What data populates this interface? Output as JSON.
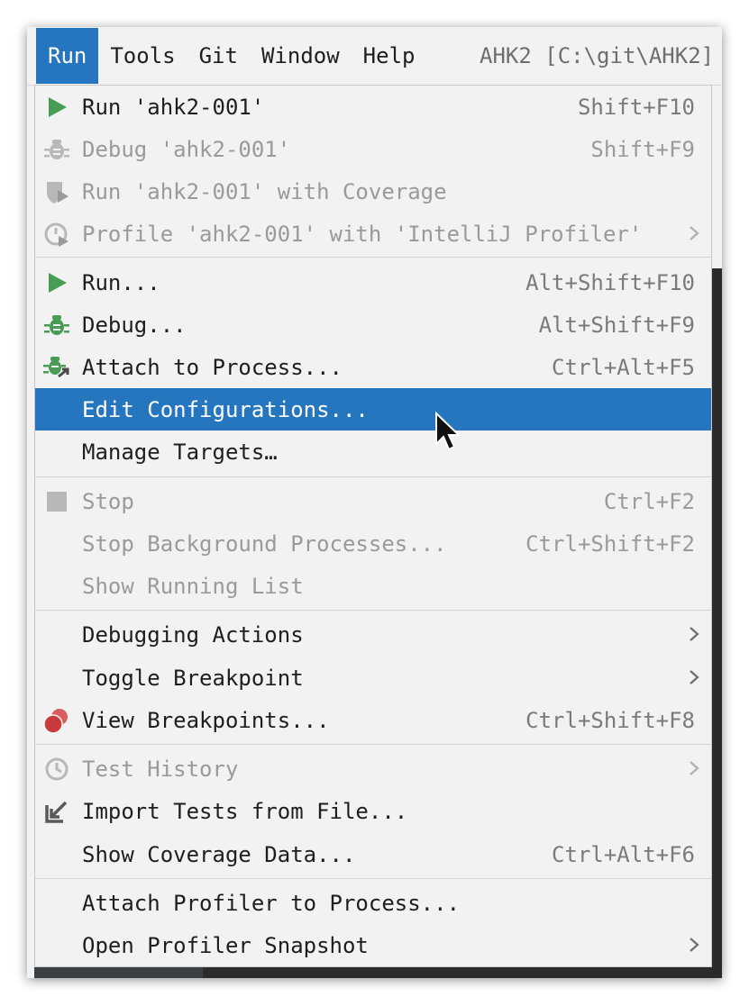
{
  "menubar": {
    "items": [
      {
        "label": "Run",
        "active": true
      },
      {
        "label": "Tools"
      },
      {
        "label": "Git"
      },
      {
        "label": "Window"
      },
      {
        "label": "Help"
      }
    ],
    "project_title": "AHK2 [C:\\git\\AHK2]"
  },
  "menu": {
    "rows": [
      {
        "label": "Run 'ahk2-001'",
        "shortcut": "Shift+F10",
        "icon": "run-play-icon",
        "enabled": true
      },
      {
        "label": "Debug 'ahk2-001'",
        "shortcut": "Shift+F9",
        "icon": "debug-bug-icon",
        "enabled": false
      },
      {
        "label": "Run 'ahk2-001' with Coverage",
        "shortcut": "",
        "icon": "coverage-shield-icon",
        "enabled": false
      },
      {
        "label": "Profile 'ahk2-001' with 'IntelliJ Profiler'",
        "shortcut": "",
        "icon": "profiler-icon",
        "enabled": false,
        "submenu": true
      },
      {
        "label": "Run...",
        "shortcut": "Alt+Shift+F10",
        "icon": "run-play-icon",
        "enabled": true
      },
      {
        "label": "Debug...",
        "shortcut": "Alt+Shift+F9",
        "icon": "debug-bug-icon",
        "enabled": true
      },
      {
        "label": "Attach to Process...",
        "shortcut": "Ctrl+Alt+F5",
        "icon": "attach-process-icon",
        "enabled": true
      },
      {
        "label": "Edit Configurations...",
        "shortcut": "",
        "icon": "",
        "enabled": true,
        "selected": true
      },
      {
        "label": "Manage Targets…",
        "shortcut": "",
        "icon": "",
        "enabled": true
      },
      {
        "label": "Stop",
        "shortcut": "Ctrl+F2",
        "icon": "stop-square-icon",
        "enabled": false
      },
      {
        "label": "Stop Background Processes...",
        "shortcut": "Ctrl+Shift+F2",
        "icon": "",
        "enabled": false
      },
      {
        "label": "Show Running List",
        "shortcut": "",
        "icon": "",
        "enabled": false
      },
      {
        "label": "Debugging Actions",
        "shortcut": "",
        "icon": "",
        "enabled": true,
        "submenu": true
      },
      {
        "label": "Toggle Breakpoint",
        "shortcut": "",
        "icon": "",
        "enabled": true,
        "submenu": true
      },
      {
        "label": "View Breakpoints...",
        "shortcut": "Ctrl+Shift+F8",
        "icon": "breakpoints-icon",
        "enabled": true
      },
      {
        "label": "Test History",
        "shortcut": "",
        "icon": "history-clock-icon",
        "enabled": false,
        "submenu": true
      },
      {
        "label": "Import Tests from File...",
        "shortcut": "",
        "icon": "import-arrow-icon",
        "enabled": true
      },
      {
        "label": "Show Coverage Data...",
        "shortcut": "Ctrl+Alt+F6",
        "icon": "",
        "enabled": true
      },
      {
        "label": "Attach Profiler to Process...",
        "shortcut": "",
        "icon": "",
        "enabled": true
      },
      {
        "label": "Open Profiler Snapshot",
        "shortcut": "",
        "icon": "",
        "enabled": true,
        "submenu": true
      }
    ]
  },
  "colors": {
    "selection": "#2675bf",
    "menu_background": "#f2f2f2",
    "run_green": "#499c54",
    "breakpoint_red": "#db5c5c",
    "disabled_text": "#9a9a9a"
  }
}
